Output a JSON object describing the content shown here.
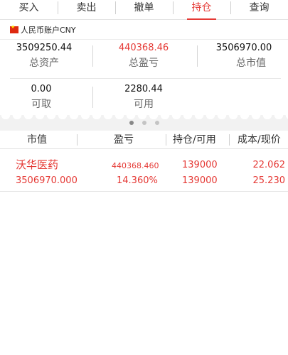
{
  "tabs": [
    {
      "label": "买入"
    },
    {
      "label": "卖出"
    },
    {
      "label": "撤单"
    },
    {
      "label": "持仓",
      "active": true
    },
    {
      "label": "查询"
    }
  ],
  "account": {
    "label": "人民币账户CNY",
    "flag_icon": "china-flag-icon"
  },
  "summary": {
    "total_assets": {
      "value": "3509250.44",
      "label": "总资产"
    },
    "total_pnl": {
      "value": "440368.46",
      "label": "总盈亏"
    },
    "total_market_value": {
      "value": "3506970.00",
      "label": "总市值"
    },
    "withdrawable": {
      "value": "0.00",
      "label": "可取"
    },
    "available": {
      "value": "2280.44",
      "label": "可用"
    }
  },
  "pager": {
    "page_count": 3,
    "current_page": 1
  },
  "table": {
    "headers": [
      "市值",
      "盈亏",
      "持仓/可用",
      "成本/现价"
    ],
    "rows": [
      {
        "name": "沃华医药",
        "market_value": "3506970.000",
        "pnl": "440368.460",
        "pnl_pct": "14.360%",
        "position": "139000",
        "available": "139000",
        "cost": "22.062",
        "price": "25.230"
      }
    ]
  },
  "colors": {
    "accent": "#e53935",
    "text": "#333333",
    "muted": "#666666",
    "divider": "#e3e3e3"
  }
}
